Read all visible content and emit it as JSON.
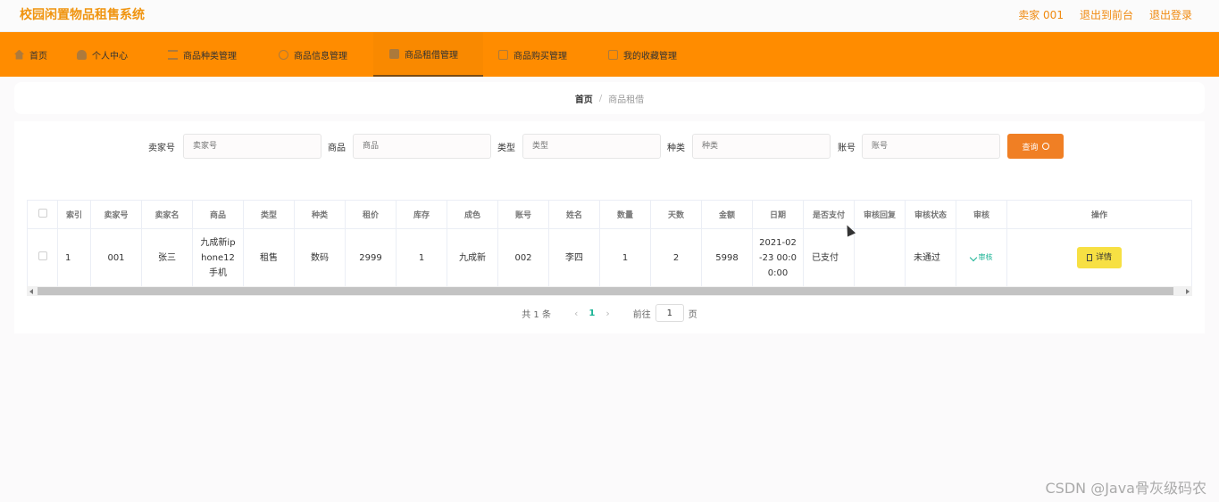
{
  "header": {
    "title": "校园闲置物品租售系统",
    "links": [
      "卖家 001",
      "退出到前台",
      "退出登录"
    ]
  },
  "nav": [
    {
      "label": "首页",
      "icon": "home-icon"
    },
    {
      "label": "个人中心",
      "icon": "user-icon"
    },
    {
      "label": "商品种类管理",
      "icon": "list-icon"
    },
    {
      "label": "商品信息管理",
      "icon": "info-icon"
    },
    {
      "label": "商品租借管理",
      "icon": "rent-icon",
      "active": true
    },
    {
      "label": "商品购买管理",
      "icon": "buy-icon"
    },
    {
      "label": "我的收藏管理",
      "icon": "collect-icon"
    }
  ],
  "breadcrumb": {
    "home": "首页",
    "sep": "/",
    "current": "商品租借"
  },
  "search": {
    "fields": [
      {
        "label": "卖家号",
        "placeholder": "卖家号"
      },
      {
        "label": "商品",
        "placeholder": "商品"
      },
      {
        "label": "类型",
        "placeholder": "类型"
      },
      {
        "label": "种类",
        "placeholder": "种类"
      },
      {
        "label": "账号",
        "placeholder": "账号"
      }
    ],
    "button_label": "查询"
  },
  "table": {
    "headers": [
      "索引",
      "卖家号",
      "卖家名",
      "商品",
      "类型",
      "种类",
      "租价",
      "库存",
      "成色",
      "账号",
      "姓名",
      "数量",
      "天数",
      "金额",
      "日期",
      "是否支付",
      "审核回复",
      "审核状态",
      "审核",
      "操作"
    ],
    "rows": [
      {
        "index": "1",
        "seller_no": "001",
        "seller_name": "张三",
        "product": "九成新ip hone12 手机",
        "type": "租售",
        "category": "数码",
        "rent_price": "2999",
        "stock": "1",
        "condition": "九成新",
        "account": "002",
        "name": "李四",
        "quantity": "1",
        "days": "2",
        "amount": "5998",
        "date": "2021-02 -23 00:0 0:00",
        "paid": "已支付",
        "audit_reply": "",
        "audit_status": "未通过",
        "audit_action": "审核",
        "operation": "详情"
      }
    ]
  },
  "pagination": {
    "total": "共 1 条",
    "prev": "‹",
    "page": "1",
    "next": "›",
    "goto": "前往",
    "goto_value": "1",
    "unit": "页"
  },
  "watermark": "CSDN @Java骨灰级码农",
  "colors": {
    "accent": "#ff8c00",
    "title": "#f0940f",
    "button": "#f07f24",
    "link": "#1ab394",
    "detail": "#f7e043"
  }
}
